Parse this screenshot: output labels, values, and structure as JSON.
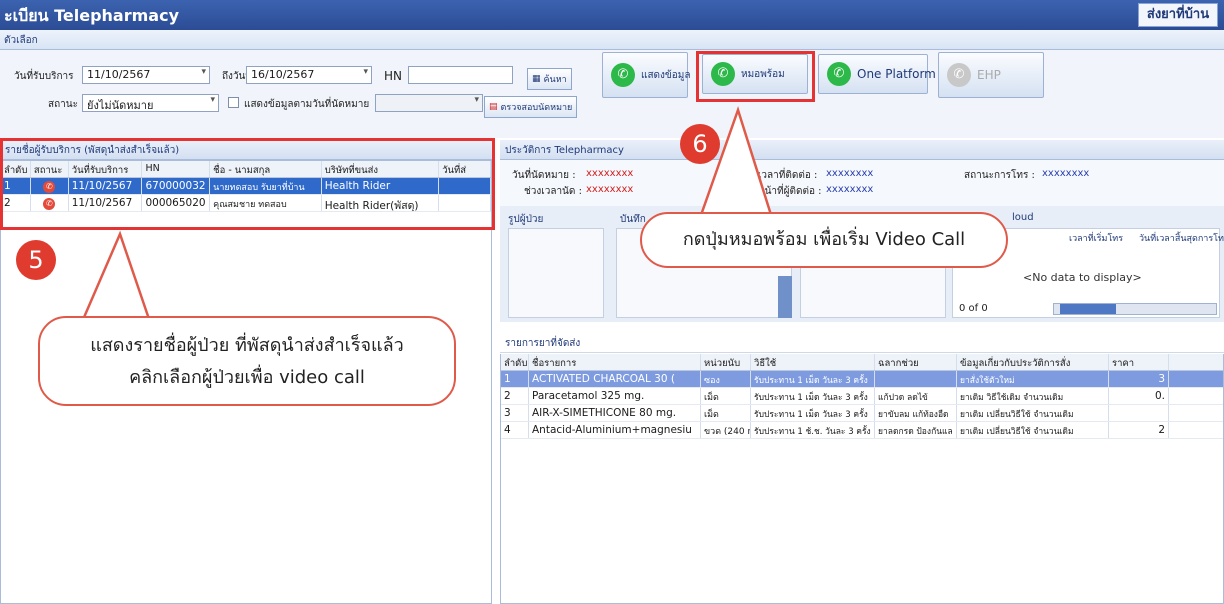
{
  "title": "ะเบียน Telepharmacy",
  "home_button": "ส่งยาที่บ้าน",
  "options_label": "ตัวเลือก",
  "filter": {
    "date_from_label": "วันที่รับบริการ",
    "date_from": "11/10/2567",
    "date_to_label": "ถึงวันที่",
    "date_to": "16/10/2567",
    "hn_label": "HN",
    "hn_value": "",
    "status_label": "สถานะ",
    "status_value": "ยังไม่นัดหมาย",
    "show_by_date_label": "แสดงข้อมูลตามวันที่นัดหมาย",
    "search_button": "ค้นหา",
    "check_appt_button": "ตรวจสอบนัดหมาย",
    "show_data_button": "แสดงข้อมูล",
    "doctor_ready_button": "หมอพร้อม",
    "one_platform_button": "One Platform",
    "ehp_button": "EHP"
  },
  "patients": {
    "header": "รายชื่อผู้รับบริการ (พัสดุนำส่งสำเร็จแล้ว)",
    "columns": [
      "ลำดับ",
      "สถานะ",
      "วันที่รับบริการ",
      "HN",
      "ชื่อ - นามสกุล",
      "บริษัทที่ขนส่ง",
      "วันที่ส่"
    ],
    "rows": [
      [
        "1",
        "11/10/2567",
        "670000032",
        "นายทดสอบ รับยาที่บ้าน",
        "Health Rider"
      ],
      [
        "2",
        "11/10/2567",
        "000065020",
        "คุณสมชาย ทดสอบ",
        "Health Rider(พัสดุ)"
      ]
    ]
  },
  "history": {
    "header": "ประวัติการ Telepharmacy",
    "appt_date_label": "วันที่นัดหมาย :",
    "appt_date": "xxxxxxxx",
    "time_label": "ช่วงเวลานัด :",
    "time": "xxxxxxxx",
    "contact_time_label": "เวลาที่ติดต่อ :",
    "contact_time": "xxxxxxxx",
    "contact_person_label": "หน้าที่ผู้ติดต่อ :",
    "contact_person": "xxxxxxxx",
    "call_status_label": "สถานะการโทร :",
    "call_status": "xxxxxxxx",
    "patient_photo_label": "รูปผู้ป่วย",
    "record_label": "บันทึก",
    "cloud_label": "loud",
    "call_start_col": "เวลาที่เริ่มโทร",
    "call_end_col": "วันที่เวลาสิ้นสุดการโทร",
    "no_data": "<No data to display>",
    "pager": "0 of 0"
  },
  "drugs": {
    "header": "รายการยาที่จัดส่ง",
    "columns": [
      "ลำดับ",
      "ชื่อรายการ",
      "หน่วยนับ",
      "วิธีใช้",
      "ฉลากช่วย",
      "ข้อมูลเกี่ยวกับประวัติการสั่ง",
      "ราคา"
    ],
    "rows": [
      [
        "1",
        "ACTIVATED CHARCOAL 30 (",
        "ซอง",
        "รับประทาน 1 เม็ด วันละ 3 ครั้ง",
        "",
        "ยาสั่งใช้ตัวใหม่",
        "3"
      ],
      [
        "2",
        "Paracetamol 325 mg.",
        "เม็ด",
        "รับประทาน 1 เม็ด วันละ 3 ครั้ง",
        "แก้ปวด ลดไข้",
        "ยาเดิม วิธีใช้เดิม จำนวนเดิม",
        "0."
      ],
      [
        "3",
        "AIR-X-SIMETHICONE 80 mg.",
        "เม็ด",
        "รับประทาน 1 เม็ด วันละ 3 ครั้ง",
        "ยาขับลม แก้ท้องอืด",
        "ยาเดิม เปลี่ยนวิธีใช้ จำนวนเดิม",
        ""
      ],
      [
        "4",
        "Antacid-Aluminium+magnesiu",
        "ขวด (240 r",
        "รับประทาน 1 ช้.ช. วันละ 3 ครั้ง",
        "ยาลดกรด ป้องกันแล",
        "ยาเดิม เปลี่ยนวิธีใช้ จำนวนเดิม",
        "2"
      ]
    ]
  },
  "annotations": {
    "step5": "5",
    "step6": "6",
    "callout6": "กดปุ่มหมอพร้อม เพื่อเริ่ม Video Call",
    "callout5_line1": "แสดงรายชื่อผู้ป่วย ที่พัสดุนำส่งสำเร็จแล้ว",
    "callout5_line2": "คลิกเลือกผู้ป่วยเพื่อ video call"
  },
  "colors": {
    "titlebar": "#2f55a4",
    "selected_row": "#2f6acb",
    "annotation_red": "#e53333",
    "phone_green": "#2db84a"
  }
}
